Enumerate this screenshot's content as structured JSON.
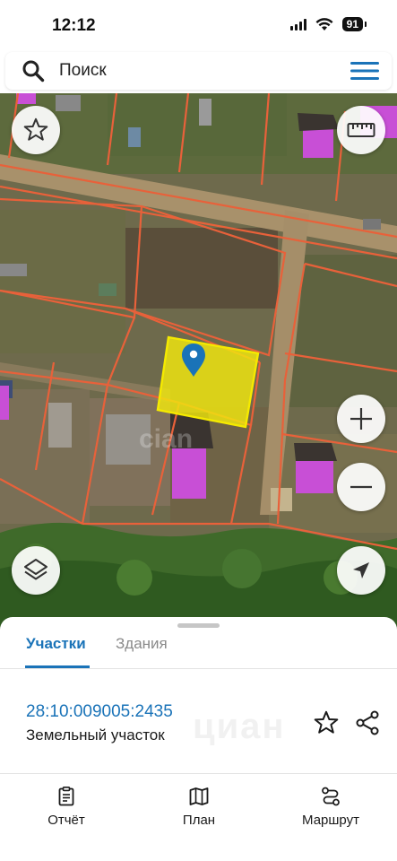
{
  "status_bar": {
    "time": "12:12",
    "battery": "91"
  },
  "search": {
    "label": "Поиск"
  },
  "map": {
    "icons": [
      "star-icon",
      "ruler-icon",
      "plus-icon",
      "minus-icon",
      "layers-icon",
      "location-arrow-icon",
      "map-pin-icon"
    ],
    "watermark": "cian",
    "colors": {
      "parcel_border": "#e8613a",
      "selected_parcel": "#f2e80f",
      "building": "#c84fd6",
      "pin": "#1a73b8"
    }
  },
  "panel": {
    "tabs": [
      {
        "label": "Участки",
        "active": true
      },
      {
        "label": "Здания",
        "active": false
      }
    ],
    "parcel": {
      "cadastral_number": "28:10:009005:2435",
      "type": "Земельный участок"
    },
    "watermark": "циан"
  },
  "bottom_nav": [
    {
      "label": "Отчёт",
      "icon": "clipboard-icon"
    },
    {
      "label": "План",
      "icon": "map-icon"
    },
    {
      "label": "Маршрут",
      "icon": "route-icon"
    }
  ],
  "colors": {
    "accent": "#1a73b8"
  }
}
